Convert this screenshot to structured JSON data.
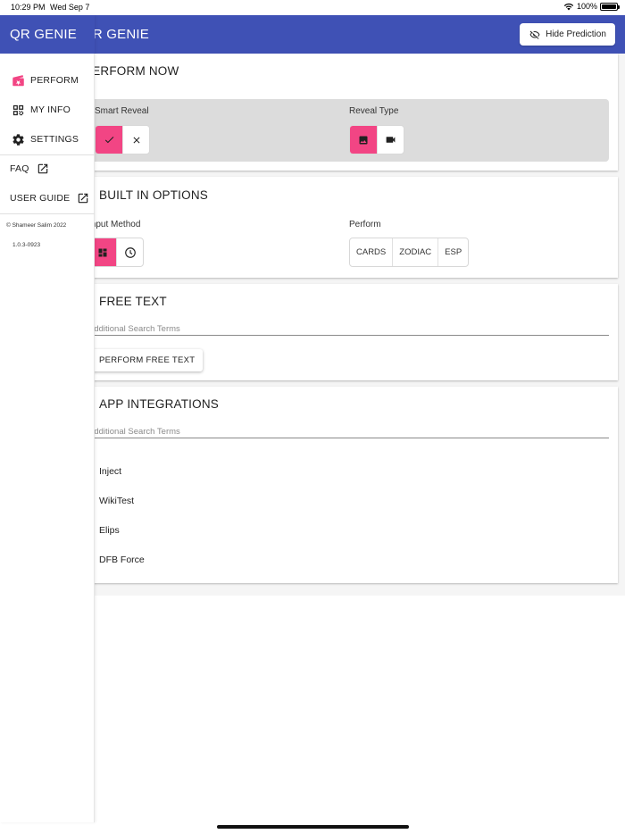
{
  "status_bar": {
    "time": "10:29 PM",
    "date": "Wed Sep 7",
    "battery": "100%"
  },
  "app_bar": {
    "title": "QR GENIE",
    "hide_prediction_label": "Hide Prediction"
  },
  "drawer": {
    "title": "QR GENIE",
    "items": [
      {
        "label": "PERFORM",
        "icon": "clapperboard-icon"
      },
      {
        "label": "MY INFO",
        "icon": "qr-code-icon"
      },
      {
        "label": "SETTINGS",
        "icon": "gear-icon"
      }
    ],
    "links": [
      {
        "label": "FAQ",
        "icon": "external-link-icon"
      },
      {
        "label": "USER GUIDE",
        "icon": "external-link-icon"
      }
    ],
    "copyright": "© Shameer Salim 2022",
    "version": "1.0.3-0923"
  },
  "perform_now": {
    "title": "PERFORM NOW",
    "smart_reveal": {
      "label": "Smart Reveal",
      "selected": "check"
    },
    "reveal_type": {
      "label": "Reveal Type",
      "selected": "image"
    }
  },
  "built_in": {
    "title": "BUILT IN OPTIONS",
    "input_method": {
      "label": "Input Method",
      "selected": "grid"
    },
    "perform": {
      "label": "Perform",
      "options": [
        "CARDS",
        "ZODIAC",
        "ESP"
      ]
    }
  },
  "free_text": {
    "title": "FREE TEXT",
    "placeholder": "Additional Search Terms",
    "button_label": "PERFORM FREE TEXT"
  },
  "app_integrations": {
    "title": "APP INTEGRATIONS",
    "placeholder": "Additional Search Terms",
    "items": [
      "Inject",
      "WikiTest",
      "Elips",
      "DFB Force"
    ]
  },
  "colors": {
    "primary": "#3f51b5",
    "accent": "#f24584",
    "background": "#f5f5f5"
  }
}
